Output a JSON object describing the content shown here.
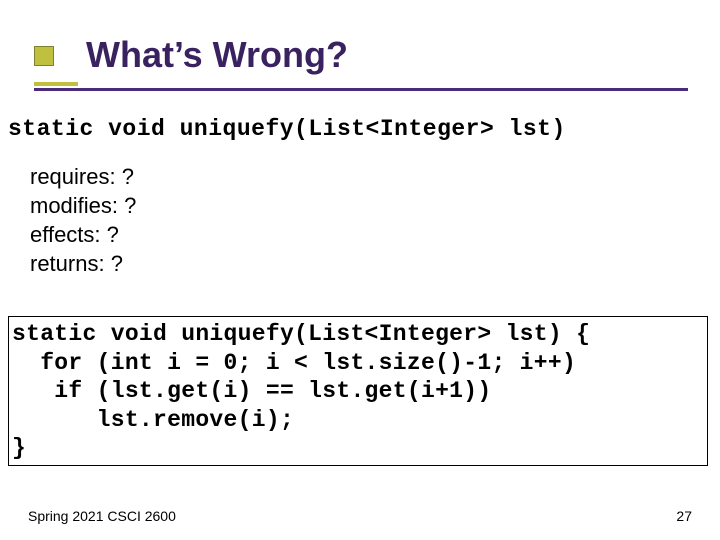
{
  "title": "What’s Wrong?",
  "signature": "static void uniquefy(List<Integer> lst)",
  "spec": {
    "requires": "requires: ?",
    "modifies": "modifies: ?",
    "effects": "effects: ?",
    "returns": "returns: ?"
  },
  "code": {
    "l1": "static void uniquefy(List<Integer> lst) {",
    "l2": "  for (int i = 0; i < lst.size()-1; i++)",
    "l3": "   if (lst.get(i) == lst.get(i+1))",
    "l4": "      lst.remove(i);",
    "l5": "}"
  },
  "footer": {
    "left": "Spring 2021 CSCI 2600",
    "right": "27"
  }
}
